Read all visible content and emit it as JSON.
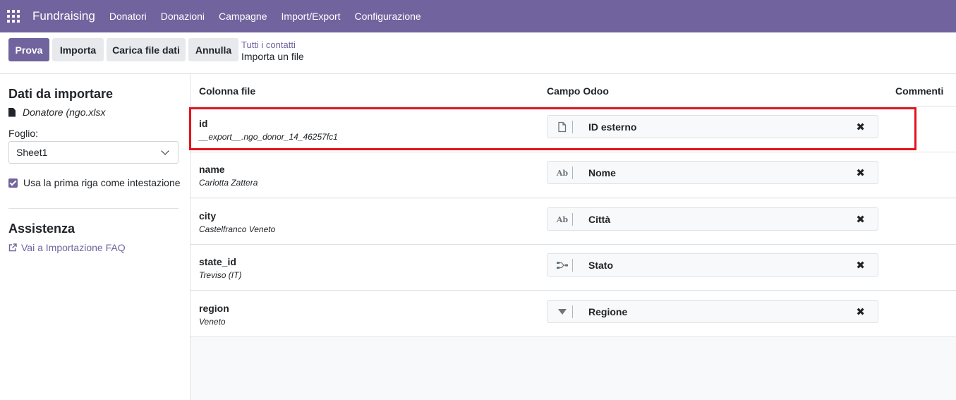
{
  "navbar": {
    "app_name": "Fundraising",
    "menu": [
      "Donatori",
      "Donazioni",
      "Campagne",
      "Import/Export",
      "Configurazione"
    ]
  },
  "control": {
    "buttons": {
      "prova": "Prova",
      "importa": "Importa",
      "carica": "Carica file dati",
      "annulla": "Annulla"
    },
    "breadcrumb": {
      "parent": "Tutti i contatti",
      "current": "Importa un file"
    }
  },
  "sidebar": {
    "title": "Dati da importare",
    "file_name": "Donatore (ngo.xlsx",
    "sheet_label": "Foglio:",
    "sheet_value": "Sheet1",
    "header_checkbox_label": "Usa la prima riga come intestazione",
    "help_title": "Assistenza",
    "faq_link": "Vai a Importazione FAQ"
  },
  "table": {
    "headers": {
      "column": "Colonna file",
      "field": "Campo Odoo",
      "comments": "Commenti"
    },
    "rows": [
      {
        "name": "id",
        "sample": "__export__.ngo_donor_14_46257fc1",
        "field": "ID esterno",
        "icon": "file-icon"
      },
      {
        "name": "name",
        "sample": "Carlotta Zattera",
        "field": "Nome",
        "icon": "text-icon",
        "icon_text": "Ab"
      },
      {
        "name": "city",
        "sample": "Castelfranco Veneto",
        "field": "Città",
        "icon": "text-icon",
        "icon_text": "Ab"
      },
      {
        "name": "state_id",
        "sample": "Treviso (IT)",
        "field": "Stato",
        "icon": "relation-icon"
      },
      {
        "name": "region",
        "sample": "Veneto",
        "field": "Regione",
        "icon": "selection-icon"
      }
    ],
    "clear_glyph": "✖"
  },
  "colors": {
    "brand": "#71639e",
    "highlight": "#e3141c"
  }
}
